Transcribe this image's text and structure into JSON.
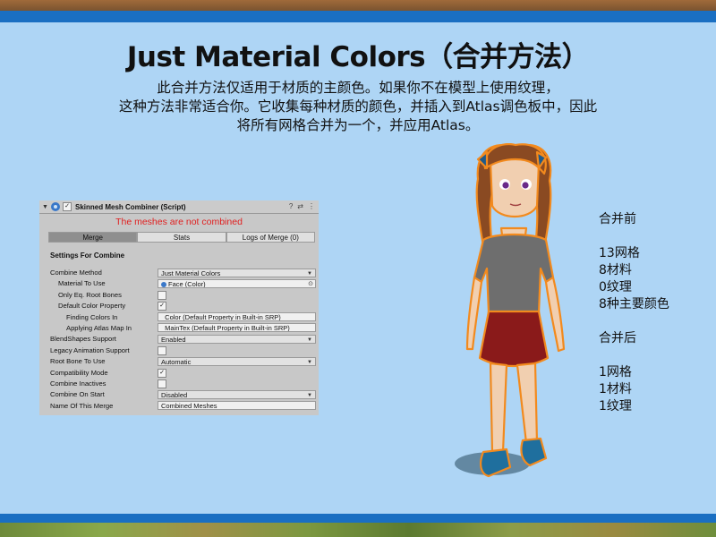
{
  "slide": {
    "title": "Just Material Colors（合并方法）",
    "desc_lines": [
      "此合并方法仅适用于材质的主颜色。如果你不在模型上使用纹理，",
      "这种方法非常适合你。它收集每种材质的颜色，并插入到Atlas调色板中，因此",
      "将所有网格合并为一个，并应用Atlas。"
    ]
  },
  "inspector": {
    "component_title": "Skinned Mesh Combiner (Script)",
    "enabled_check": "✓",
    "header_icons": {
      "help": "?",
      "presets": "⇄",
      "more": "⋮"
    },
    "warning": "The meshes are not combined",
    "tabs": [
      "Merge",
      "Stats",
      "Logs of Merge (0)"
    ],
    "active_tab": "Merge",
    "section_title": "Settings For Combine",
    "rows": [
      {
        "label": "Combine Method",
        "type": "dropdown",
        "value": "Just Material Colors",
        "indent": 0
      },
      {
        "label": "Material To Use",
        "type": "object",
        "value": "Face (Color)",
        "indent": 1
      },
      {
        "label": "Only Eq. Root Bones",
        "type": "checkbox",
        "checked": false,
        "indent": 1
      },
      {
        "label": "Default Color Property",
        "type": "checkbox",
        "checked": true,
        "indent": 1
      },
      {
        "label": "Finding Colors In",
        "type": "text",
        "value": "_Color (Default Property in Built-in SRP)",
        "indent": 2
      },
      {
        "label": "Applying Atlas Map In",
        "type": "text",
        "value": "_MainTex (Default Property in Built-in SRP)",
        "indent": 2
      },
      {
        "label": "BlendShapes Support",
        "type": "dropdown",
        "value": "Enabled",
        "indent": 0
      },
      {
        "label": "Legacy Animation Support",
        "type": "checkbox",
        "checked": false,
        "indent": 0
      },
      {
        "label": "Root Bone To Use",
        "type": "dropdown",
        "value": "Automatic",
        "indent": 0
      },
      {
        "label": "Compatibility Mode",
        "type": "checkbox",
        "checked": true,
        "indent": 0
      },
      {
        "label": "Combine Inactives",
        "type": "checkbox",
        "checked": false,
        "indent": 0
      },
      {
        "label": "Combine On Start",
        "type": "dropdown",
        "value": "Disabled",
        "indent": 0
      },
      {
        "label": "Name Of This Merge",
        "type": "text",
        "value": "Combined Meshes",
        "indent": 0
      }
    ]
  },
  "stats": {
    "before_title": "合并前",
    "before": [
      "13网格",
      "8材料",
      "0纹理",
      "8种主要颜色"
    ],
    "after_title": "合并后",
    "after": [
      "1网格",
      "1材料",
      "1纹理"
    ]
  },
  "colors": {
    "slide_bg": "#aed5f5",
    "band_blue": "#1a6fc2",
    "warning_red": "#e02020",
    "outline_orange": "#f28a1e",
    "hair": "#8a4a22",
    "shirt": "#6e6e6e",
    "skirt": "#8a1a1a",
    "shoes": "#1f6f9e"
  }
}
